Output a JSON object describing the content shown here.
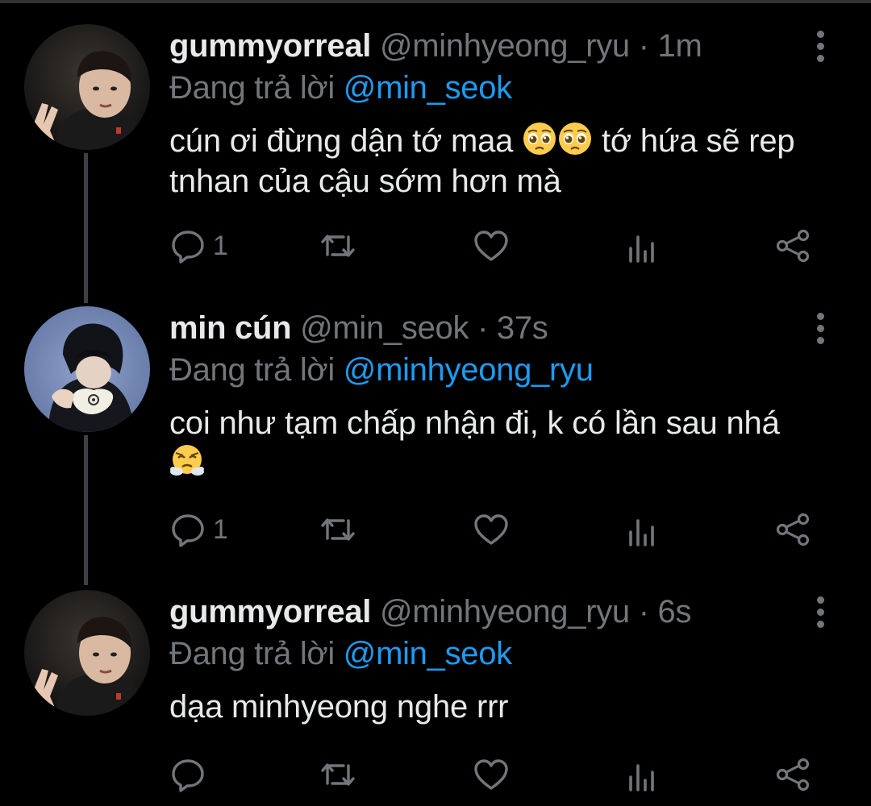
{
  "colors": {
    "background": "#000000",
    "text_primary": "#e7e9ea",
    "text_secondary": "#71767b",
    "link": "#1d9bf0",
    "thread_line": "#3d4146"
  },
  "reply_prefix": "Đang trả lời",
  "tweets": [
    {
      "display_name": "gummyorreal",
      "handle": "@minhyeong_ryu",
      "separator": "·",
      "time": "1m",
      "reply_to": "@min_seok",
      "text_before_emoji": "cún ơi đừng dận tớ maa ",
      "emoji": [
        "pleading-face-emoji",
        "pleading-face-emoji"
      ],
      "text_after_emoji": " tớ hứa sẽ rep tnhan của cậu sớm hơn mà",
      "reply_count": "1",
      "icons": [
        "reply-icon",
        "retweet-icon",
        "like-icon",
        "views-icon",
        "share-icon"
      ]
    },
    {
      "display_name": "min cún",
      "handle": "@min_seok",
      "separator": "·",
      "time": "37s",
      "reply_to": "@minhyeong_ryu",
      "text_before_emoji": "coi như tạm chấp nhận đi, k có lần sau nhá",
      "emoji": [
        "face-with-steam-emoji"
      ],
      "text_after_emoji": "",
      "reply_count": "1",
      "icons": [
        "reply-icon",
        "retweet-icon",
        "like-icon",
        "views-icon",
        "share-icon"
      ]
    },
    {
      "display_name": "gummyorreal",
      "handle": "@minhyeong_ryu",
      "separator": "·",
      "time": "6s",
      "reply_to": "@min_seok",
      "text_before_emoji": "dạa minhyeong nghe rrr",
      "emoji": [],
      "text_after_emoji": "",
      "reply_count": "",
      "icons": [
        "reply-icon",
        "retweet-icon",
        "like-icon",
        "views-icon",
        "share-icon"
      ]
    }
  ]
}
